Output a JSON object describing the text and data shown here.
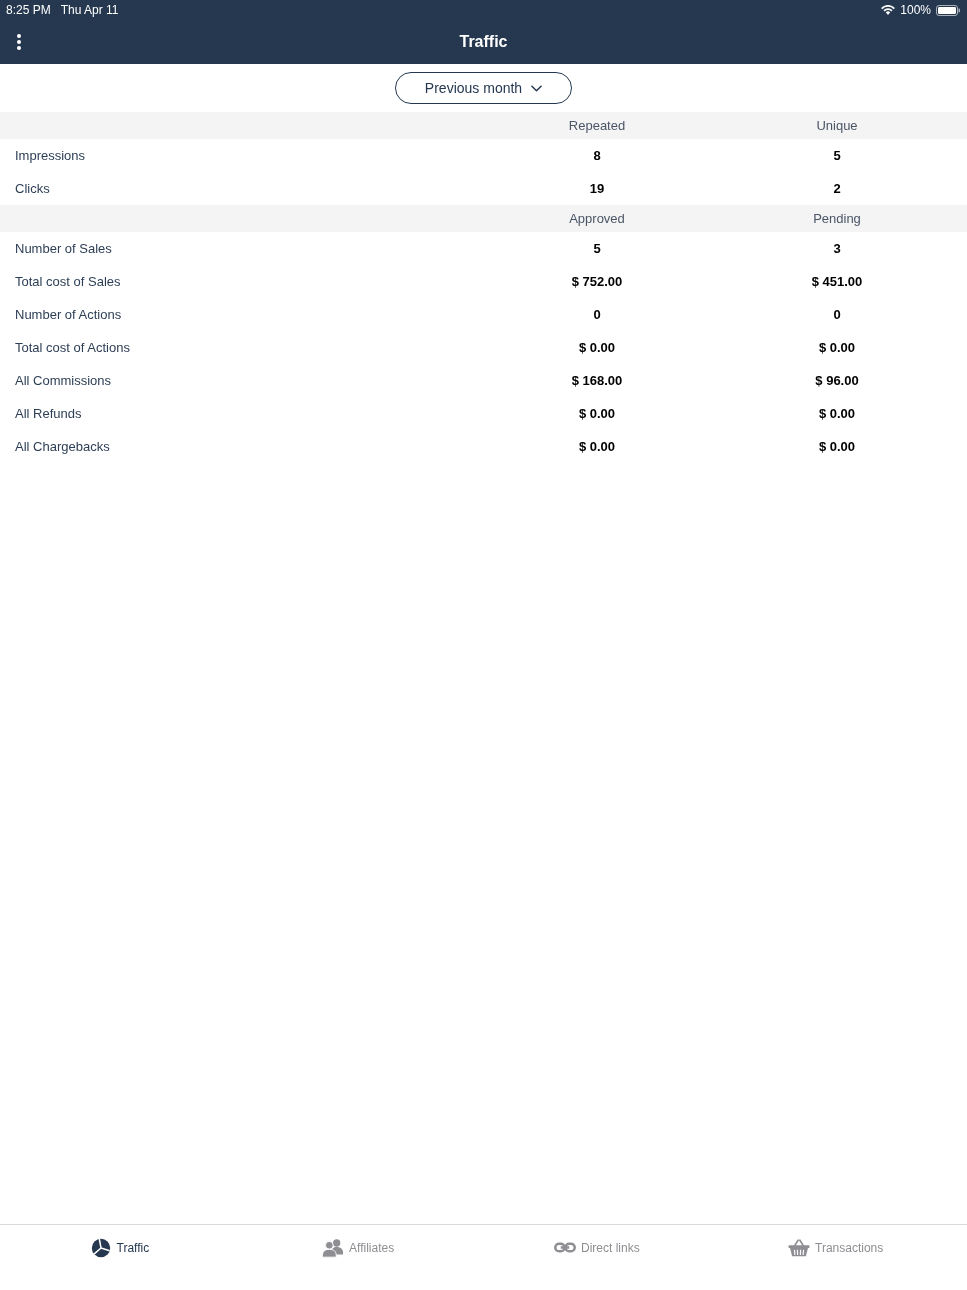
{
  "status_bar": {
    "time": "8:25 PM",
    "date": "Thu Apr 11",
    "battery": "100%"
  },
  "header": {
    "title": "Traffic"
  },
  "period_dropdown": {
    "label": "Previous month"
  },
  "sections": [
    {
      "columns": [
        "Repeated",
        "Unique"
      ],
      "rows": [
        {
          "label": "Impressions",
          "values": [
            "8",
            "5"
          ]
        },
        {
          "label": "Clicks",
          "values": [
            "19",
            "2"
          ]
        }
      ]
    },
    {
      "columns": [
        "Approved",
        "Pending"
      ],
      "rows": [
        {
          "label": "Number of Sales",
          "values": [
            "5",
            "3"
          ]
        },
        {
          "label": "Total cost of Sales",
          "values": [
            "$ 752.00",
            "$ 451.00"
          ]
        },
        {
          "label": "Number of Actions",
          "values": [
            "0",
            "0"
          ]
        },
        {
          "label": "Total cost of Actions",
          "values": [
            "$ 0.00",
            "$ 0.00"
          ]
        },
        {
          "label": "All Commissions",
          "values": [
            "$ 168.00",
            "$ 96.00"
          ]
        },
        {
          "label": "All Refunds",
          "values": [
            "$ 0.00",
            "$ 0.00"
          ]
        },
        {
          "label": "All Chargebacks",
          "values": [
            "$ 0.00",
            "$ 0.00"
          ]
        }
      ]
    }
  ],
  "tab_bar": {
    "tabs": [
      {
        "kind": "chart",
        "label": "Traffic",
        "selected": true
      },
      {
        "kind": "people",
        "label": "Affiliates",
        "selected": false
      },
      {
        "kind": "link",
        "label": "Direct links",
        "selected": false
      },
      {
        "kind": "basket",
        "label": "Transactions",
        "selected": false
      }
    ]
  }
}
